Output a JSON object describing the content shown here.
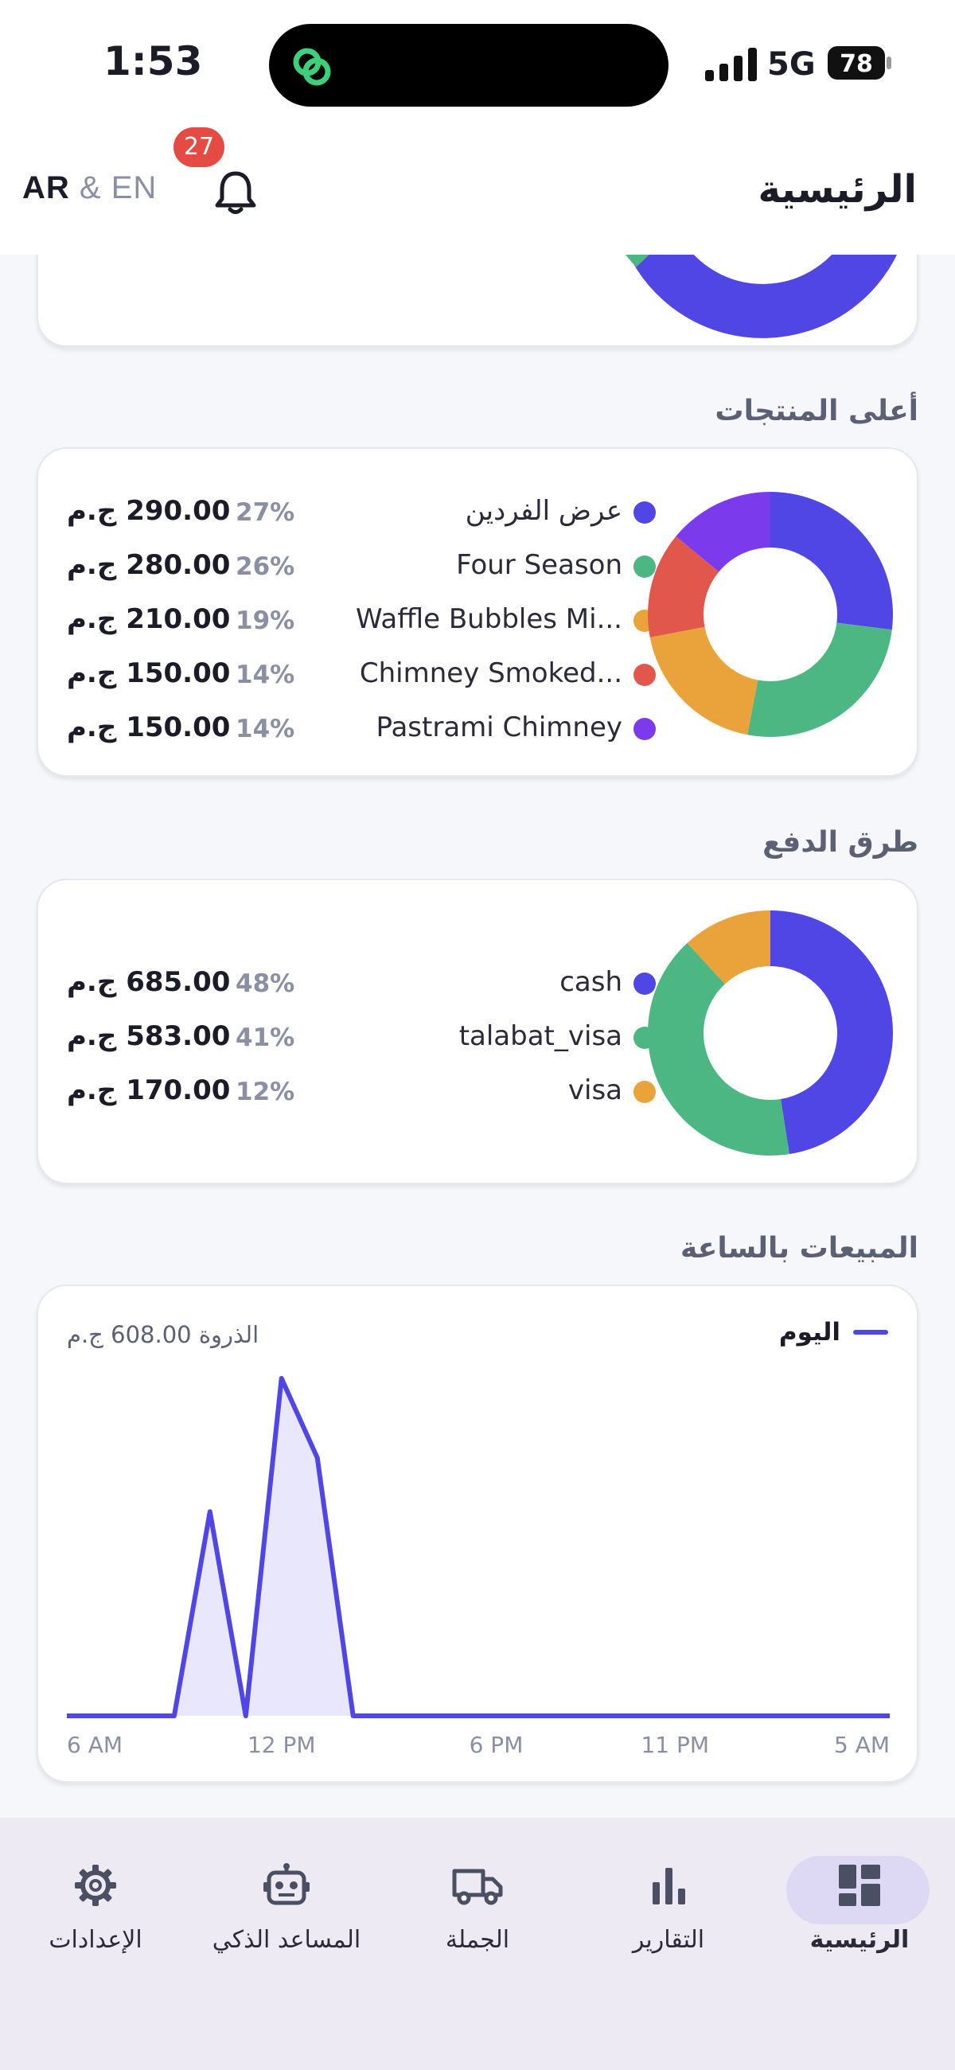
{
  "status_bar": {
    "time": "1:53",
    "network": "5G",
    "battery": "78"
  },
  "header": {
    "lang_ar": "AR",
    "lang_rest": "& EN",
    "notifications_count": "27",
    "title": "الرئيسية"
  },
  "top_products": {
    "section_title": "أعلى المنتجات",
    "items": [
      {
        "name": "عرض الفردين",
        "percent": "27%",
        "amount": "290.00 ج.م",
        "color": "#4f46e5"
      },
      {
        "name": "Four Season",
        "percent": "26%",
        "amount": "280.00 ج.م",
        "color": "#4cb782"
      },
      {
        "name": "Waffle Bubbles Mi...",
        "percent": "19%",
        "amount": "210.00 ج.م",
        "color": "#eaa23a"
      },
      {
        "name": "Chimney Smoked...",
        "percent": "14%",
        "amount": "150.00 ج.م",
        "color": "#e2574c"
      },
      {
        "name": "Pastrami Chimney",
        "percent": "14%",
        "amount": "150.00 ج.م",
        "color": "#7c3aed"
      }
    ]
  },
  "payment_methods": {
    "section_title": "طرق الدفع",
    "items": [
      {
        "name": "cash",
        "percent": "48%",
        "amount": "685.00 ج.م",
        "color": "#4f46e5"
      },
      {
        "name": "talabat_visa",
        "percent": "41%",
        "amount": "583.00 ج.م",
        "color": "#4cb782"
      },
      {
        "name": "visa",
        "percent": "12%",
        "amount": "170.00 ج.م",
        "color": "#eaa23a"
      }
    ]
  },
  "hourly_sales": {
    "section_title": "المبيعات بالساعة",
    "peak_label": "الذروة 608.00 ج.م",
    "legend_label": "اليوم",
    "color": "#4f46e5"
  },
  "chart_data": [
    {
      "type": "pie",
      "categories": [
        "عرض الفردين",
        "Four Season",
        "Waffle Bubbles Mi...",
        "Chimney Smoked...",
        "Pastrami Chimney"
      ],
      "values": [
        27,
        26,
        19,
        14,
        14
      ]
    },
    {
      "type": "pie",
      "categories": [
        "cash",
        "talabat_visa",
        "visa"
      ],
      "values": [
        48,
        41,
        12
      ]
    },
    {
      "type": "line",
      "series": [
        {
          "name": "اليوم",
          "values": [
            0,
            0,
            0,
            0,
            368,
            0,
            608,
            465,
            0,
            0,
            0,
            0,
            0,
            0,
            0,
            0,
            0,
            0,
            0,
            0,
            0,
            0,
            0,
            0
          ]
        }
      ],
      "x": [
        "6 AM",
        "7 AM",
        "8 AM",
        "9 AM",
        "10 AM",
        "11 AM",
        "12 PM",
        "1 PM",
        "2 PM",
        "3 PM",
        "4 PM",
        "5 PM",
        "6 PM",
        "7 PM",
        "8 PM",
        "9 PM",
        "10 PM",
        "11 PM",
        "12 AM",
        "1 AM",
        "2 AM",
        "3 AM",
        "4 AM",
        "5 AM"
      ],
      "tick_labels": [
        "6 AM",
        "12 PM",
        "6 PM",
        "11 PM",
        "5 AM"
      ],
      "ylim": [
        0,
        608
      ]
    }
  ],
  "nav": [
    {
      "key": "home",
      "label": "الرئيسية",
      "icon": "dashboard-icon",
      "active": true
    },
    {
      "key": "reports",
      "label": "التقارير",
      "icon": "bar-chart-icon"
    },
    {
      "key": "wholesale",
      "label": "الجملة",
      "icon": "truck-icon"
    },
    {
      "key": "assistant",
      "label": "المساعد الذكي",
      "icon": "robot-icon"
    },
    {
      "key": "settings",
      "label": "الإعدادات",
      "icon": "gear-icon"
    }
  ]
}
